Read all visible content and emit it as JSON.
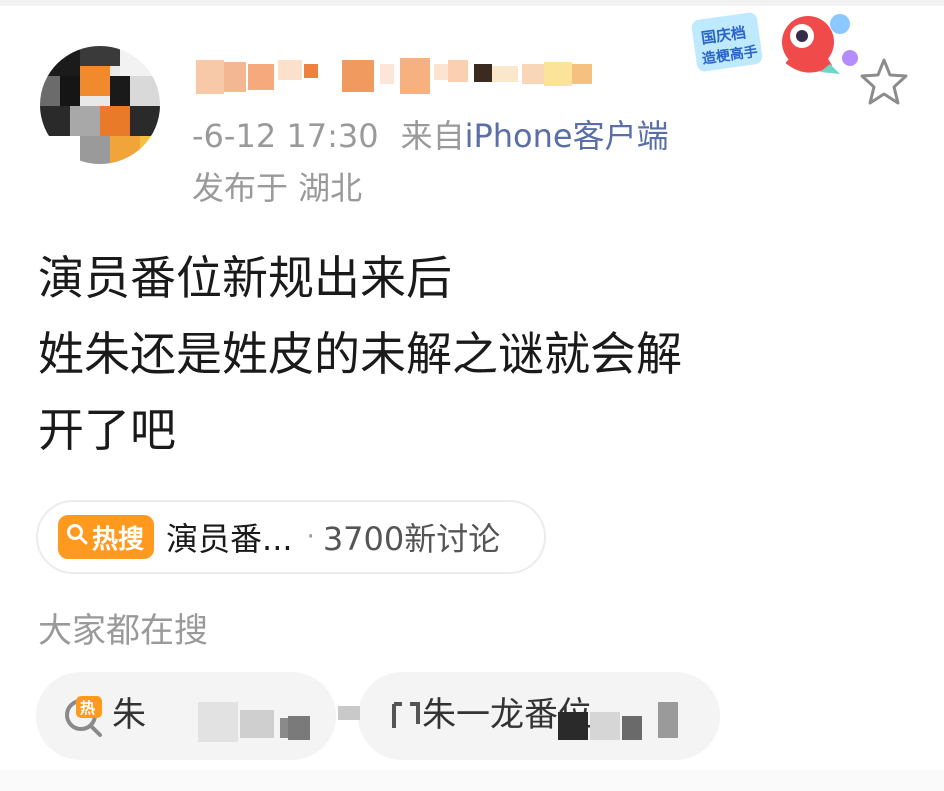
{
  "header": {
    "timestamp": "-6-12 17:30",
    "source_prefix": "来自",
    "source_client": "iPhone客户端",
    "location": "发布于 湖北",
    "badge_text_line1": "国庆档",
    "badge_text_line2": "造梗高手"
  },
  "post": {
    "lines": [
      "演员番位新规出来后",
      "姓朱还是姓皮的未解之谜就会解",
      "开了吧"
    ]
  },
  "hot_search": {
    "tag_label": "热搜",
    "title": "演员番...",
    "separator": "·",
    "count_text": "3700新讨论"
  },
  "everyone_searching": {
    "title": "大家都在搜",
    "pills": [
      {
        "text": "朱",
        "icon": "hot-search-icon"
      },
      {
        "text": "朱一龙番位",
        "icon": "search-icon"
      }
    ]
  },
  "colors": {
    "accent_orange": "#ff9a1f",
    "link_blue": "#5a6fa8",
    "meta_gray": "#9a9a9a"
  },
  "icons": {
    "star": "star-icon",
    "search_glyph": "search-icon"
  }
}
